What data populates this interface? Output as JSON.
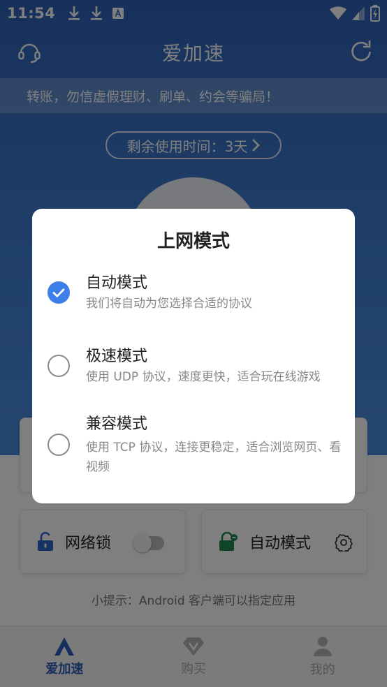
{
  "status_bar": {
    "time": "11:54"
  },
  "header": {
    "title": "爱加速"
  },
  "notice": {
    "text": "转账，勿信虚假理财、刷单、约会等骗局！"
  },
  "remaining": {
    "label": "剩余使用时间：3天"
  },
  "cards": {
    "lock_label": "网络锁",
    "mode_label": "自动模式"
  },
  "tip": "小提示：Android 客户端可以指定应用",
  "nav": [
    {
      "label": "爱加速"
    },
    {
      "label": "购买"
    },
    {
      "label": "我的"
    }
  ],
  "dialog": {
    "title": "上网模式",
    "options": [
      {
        "title": "自动模式",
        "desc": "我们将自动为您选择合适的协议",
        "selected": true
      },
      {
        "title": "极速模式",
        "desc": "使用 UDP 协议，速度更快，适合玩在线游戏",
        "selected": false
      },
      {
        "title": "兼容模式",
        "desc": "使用 TCP 协议，连接更稳定，适合浏览网页、看视频",
        "selected": false
      }
    ]
  },
  "colors": {
    "brand_blue": "#2f62b8",
    "accent": "#3d7ee8"
  }
}
